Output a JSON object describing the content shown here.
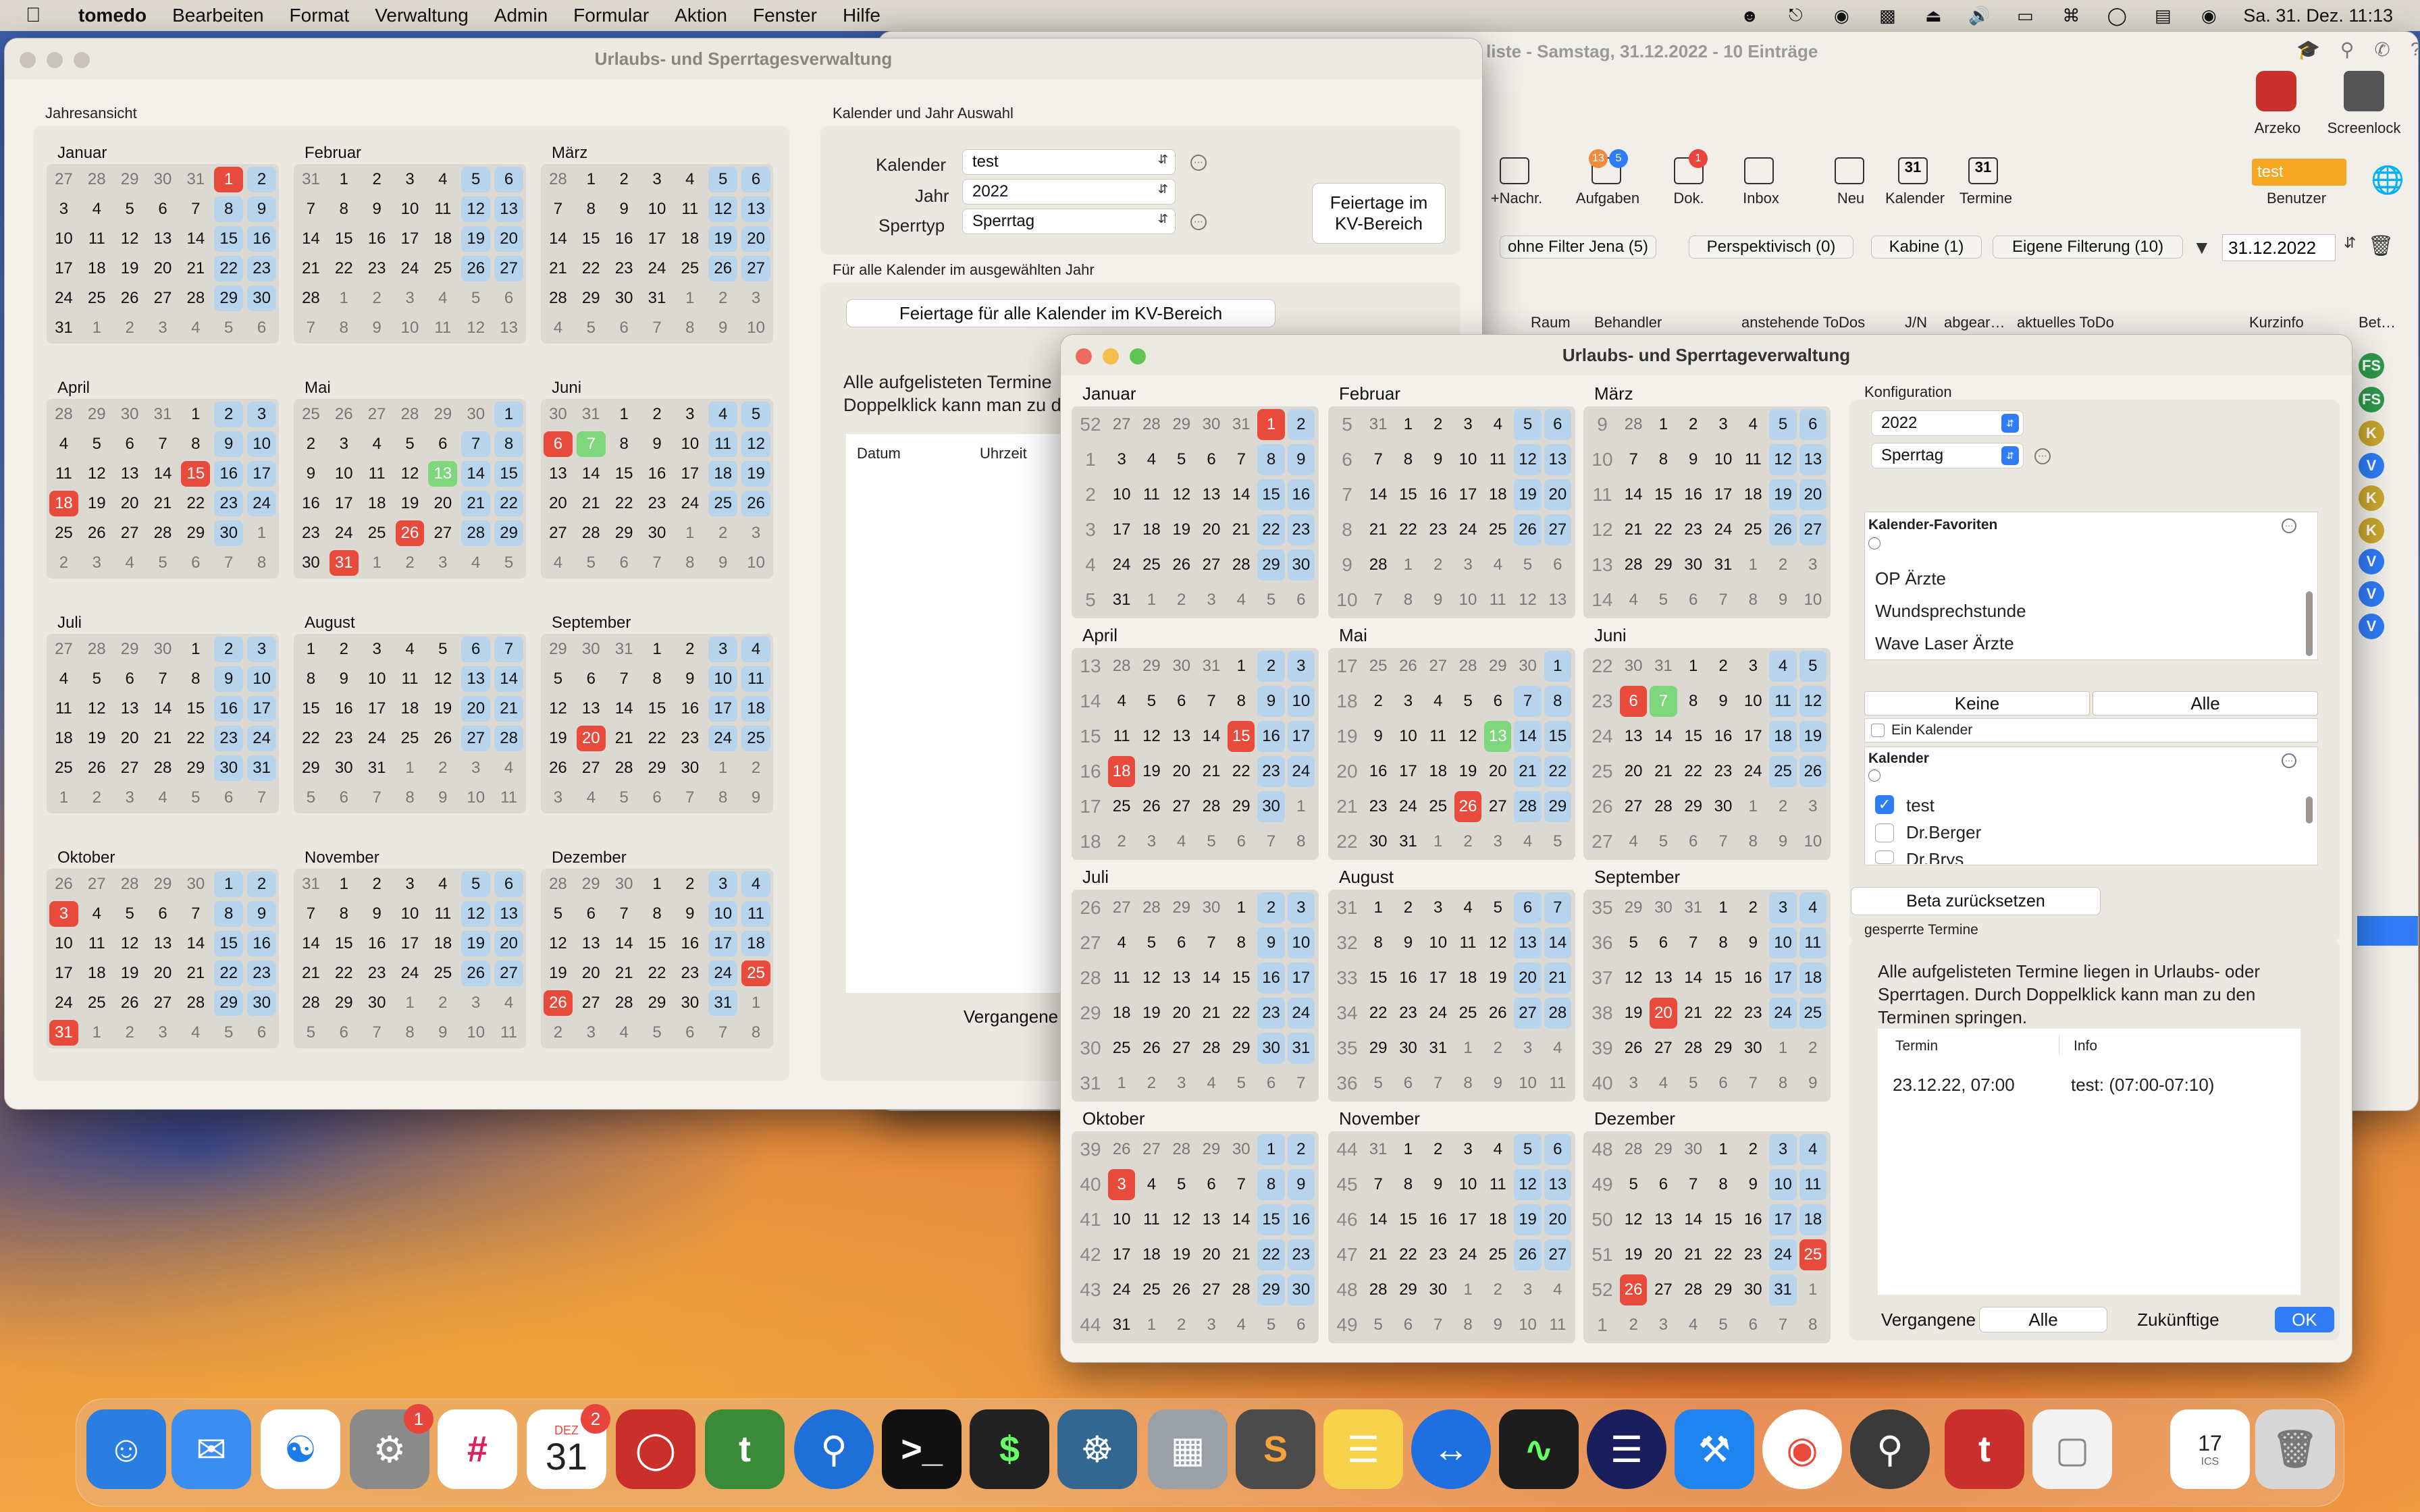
{
  "menubar": {
    "app": "tomedo",
    "items": [
      "Bearbeiten",
      "Format",
      "Verwaltung",
      "Admin",
      "Formular",
      "Aktion",
      "Fenster",
      "Hilfe"
    ],
    "clock": "Sa. 31. Dez.  11:13"
  },
  "back_window": {
    "title": "liste - Samstag, 31.12.2022 - 10 Einträge",
    "top_icons": [
      {
        "label": "Arzeko"
      },
      {
        "label": "Screenlock"
      }
    ],
    "toolbar": [
      {
        "label": "+Nachr."
      },
      {
        "label": "Aufgaben",
        "badges": [
          "13",
          "5"
        ]
      },
      {
        "label": "Dok.",
        "badges": [
          "1"
        ]
      },
      {
        "label": "Inbox"
      },
      {
        "label": "Neu"
      },
      {
        "label": "Kalender"
      },
      {
        "label": "Termine"
      },
      {
        "label": "Benutzer"
      }
    ],
    "kalender_icon_day": "31",
    "termine_icon_day": "31",
    "benutzer_value": "test",
    "filters": [
      "ohne Filter Jena (5)",
      "Perspektivisch (0)",
      "Kabine (1)",
      "Eigene Filterung (10)"
    ],
    "date": "31.12.2022",
    "columns": [
      "Raum",
      "Behandler",
      "anstehende ToDos",
      "J/N",
      "abgear…",
      "aktuelles ToDo",
      "Kurzinfo",
      "Bet…"
    ],
    "row_badges": [
      "FS",
      "FS",
      "K",
      "V",
      "K",
      "K",
      "V",
      "V",
      "V"
    ]
  },
  "win1": {
    "title": "Urlaubs- und Sperrtagesverwaltung",
    "section_label": "Jahresansicht",
    "auswahl_label": "Kalender und Jahr Auswahl",
    "kalender_label": "Kalender",
    "kalender_value": "test",
    "jahr_label": "Jahr",
    "jahr_value": "2022",
    "sperrtyp_label": "Sperrtyp",
    "sperrtyp_value": "Sperrtag",
    "feiertage_button": "Feiertage im KV-Bereich",
    "alle_kalender_label": "Für alle Kalender im ausgewählten Jahr",
    "alle_feiertage_button": "Feiertage für alle Kalender im KV-Bereich",
    "info_text": "Alle aufgelisteten Termine",
    "info_text2": "Doppelklick kann man zu d",
    "col_datum": "Datum",
    "col_uhrzeit": "Uhrzeit",
    "vergangene_button": "Vergangene"
  },
  "win2": {
    "title": "Urlaubs- und Sperrtageverwaltung",
    "konfiguration_label": "Konfiguration",
    "jahr_value": "2022",
    "sperrtyp_value": "Sperrtag",
    "favoriten_label": "Kalender-Favoriten",
    "favoriten": [
      "OP Ärzte",
      "Wundsprechstunde",
      "Wave Laser Ärzte"
    ],
    "keine_button": "Keine",
    "alle_button": "Alle",
    "ein_kalender_label": "Ein Kalender",
    "kalender_label": "Kalender",
    "kalender_items": [
      {
        "label": "test",
        "checked": true
      },
      {
        "label": "Dr.Berger",
        "checked": false
      },
      {
        "label": "Dr.Brys",
        "checked": false
      }
    ],
    "beta_button": "Beta zurücksetzen",
    "gesperrte_label": "gesperrte Termine",
    "info_text": "Alle aufgelisteten Termine liegen in Urlaubs- oder Sperrtagen. Durch Doppelklick kann man zu den Terminen springen.",
    "col_termin": "Termin",
    "col_info": "Info",
    "termin_row": {
      "termin": "23.12.22, 07:00",
      "info": "test:  (07:00-07:10)"
    },
    "seg": [
      "Vergangene",
      "Alle",
      "Zukünftige"
    ],
    "ok_button": "OK"
  },
  "calendar": {
    "year": 2022,
    "months": [
      "Januar",
      "Februar",
      "März",
      "April",
      "Mai",
      "Juni",
      "Juli",
      "August",
      "September",
      "Oktober",
      "November",
      "Dezember"
    ],
    "holidays_red": [
      "1-1",
      "4-15",
      "4-18",
      "5-26",
      "6-6",
      "9-20",
      "10-3",
      "12-25",
      "12-26"
    ],
    "holidays_red_w1_extra": [
      "5-31",
      "6-6",
      "10-31"
    ],
    "marked_green": [
      "5-13",
      "6-7"
    ]
  },
  "dock": {
    "calendar_month": "DEZ",
    "calendar_day": "31",
    "calendar_badge": "2",
    "settings_badge": "1",
    "ics_day": "17",
    "ics_label": "ICS"
  },
  "colors": {
    "accent": "#2f7cf6",
    "weekday_blue": "#b8d4ec",
    "holiday_red": "#e84b3c",
    "green": "#7fd77d"
  }
}
